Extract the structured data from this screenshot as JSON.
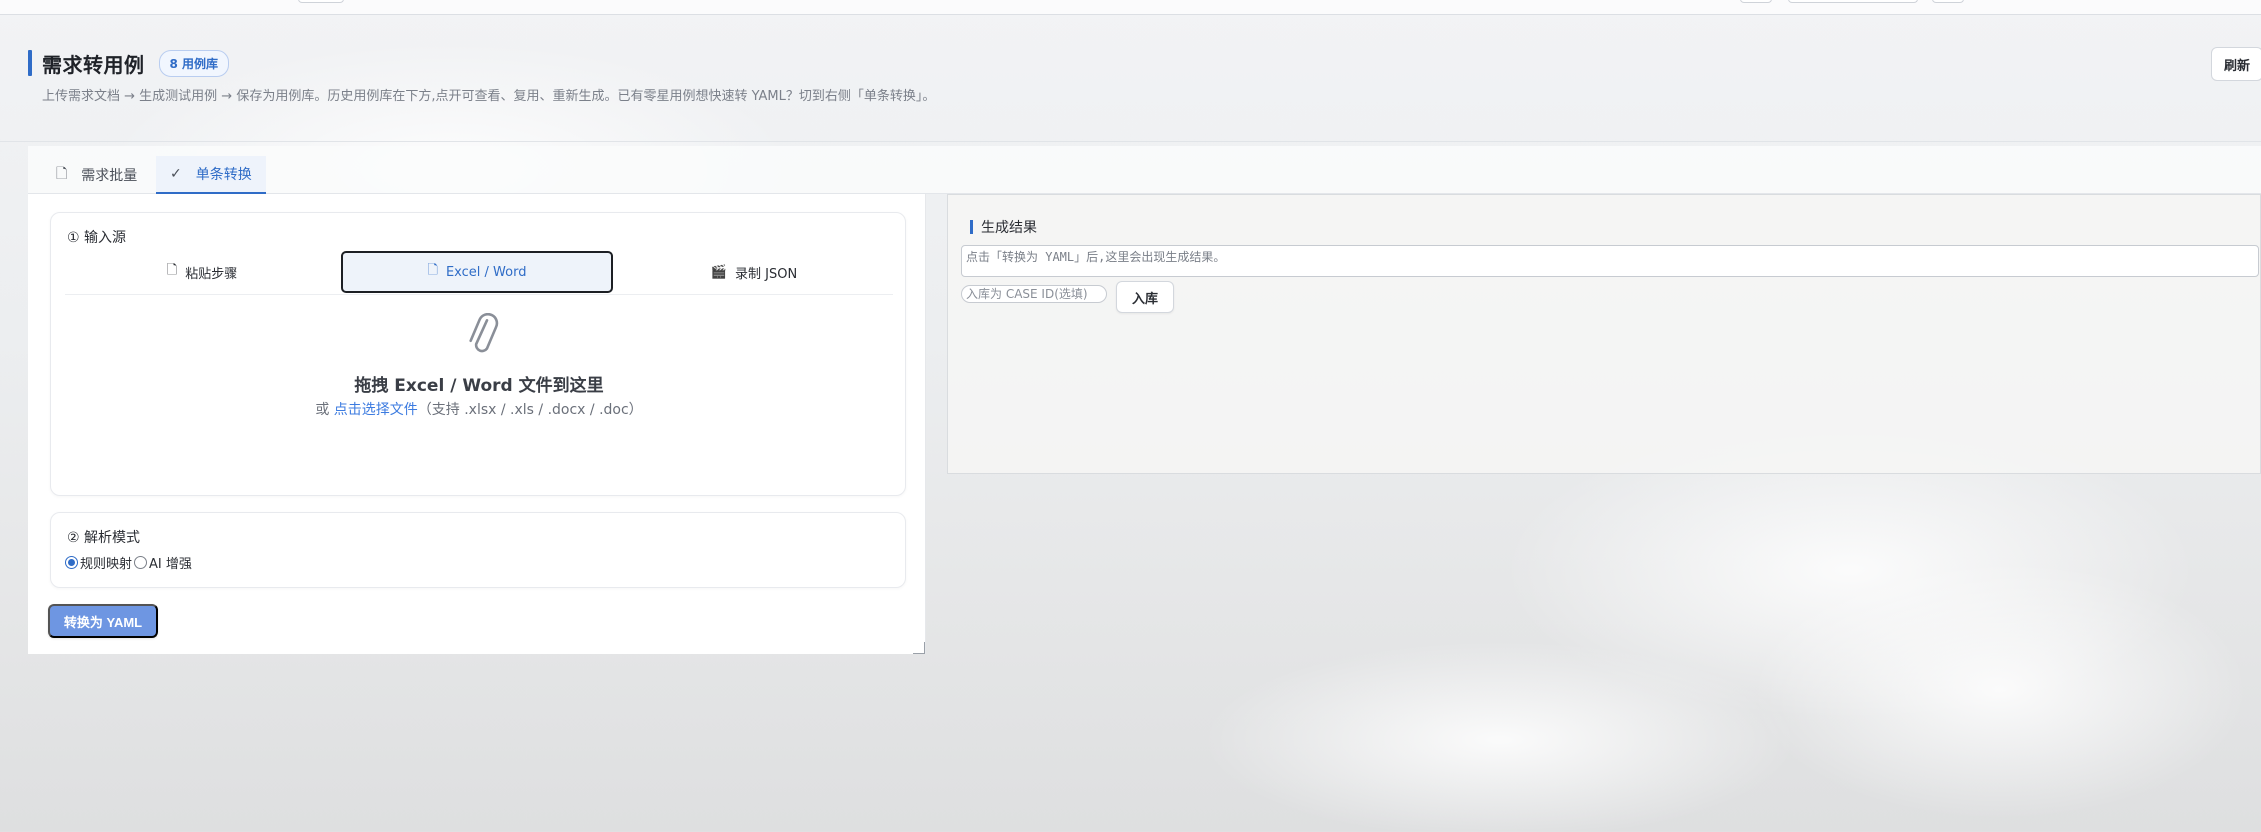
{
  "header": {
    "title": "需求转用例",
    "count_badge": "8 用例库",
    "description": "上传需求文档 → 生成测试用例 → 保存为用例库。历史用例库在下方,点开可查看、复用、重新生成。已有零星用例想快速转 YAML？切到右侧「单条转换」。",
    "refresh_label": "刷新"
  },
  "tabs": [
    {
      "label": "需求批量",
      "icon": "document-icon"
    },
    {
      "label": "单条转换",
      "icon": "check-icon",
      "active": true
    }
  ],
  "input_card": {
    "title": "① 输入源",
    "source_tabs": [
      {
        "label": "粘贴步骤",
        "icon": "document-icon"
      },
      {
        "label": "Excel / Word",
        "icon": "document-icon",
        "active": true
      },
      {
        "label": "录制 JSON",
        "icon": "clapperboard-icon"
      }
    ],
    "dropzone": {
      "icon": "paperclip-icon",
      "title": "拖拽 Excel / Word 文件到这里",
      "prefix": "或 ",
      "link": "点击选择文件",
      "suffix": "（支持 .xlsx / .xls / .docx / .doc）"
    }
  },
  "mode_card": {
    "title": "② 解析模式",
    "options": [
      {
        "label": "规则映射",
        "checked": true
      },
      {
        "label": "AI 增强",
        "checked": false
      }
    ]
  },
  "convert_label": "转换为 YAML",
  "result": {
    "title": "生成结果",
    "placeholder": "点击「转换为 YAML」后,这里会出现生成结果。",
    "case_id_placeholder": "入库为 CASE ID(选填)",
    "store_label": "入库"
  },
  "colors": {
    "accent": "#2f6cc7",
    "primary_button": "#6e96e2",
    "link": "#3c7be0"
  }
}
